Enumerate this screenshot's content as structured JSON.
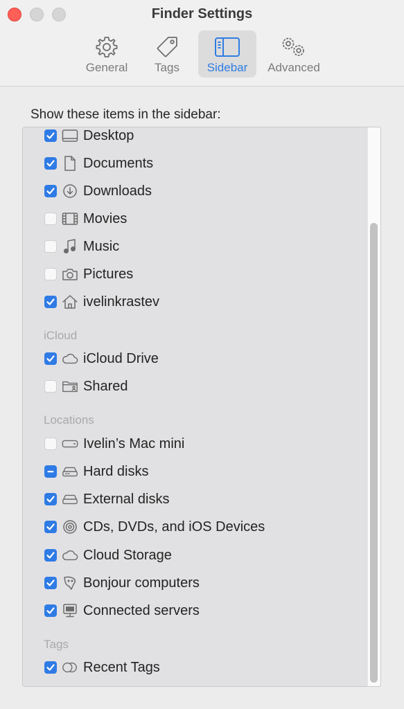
{
  "window": {
    "title": "Finder Settings"
  },
  "tabs": [
    {
      "label": "General",
      "icon": "gear-icon",
      "active": false
    },
    {
      "label": "Tags",
      "icon": "tag-icon",
      "active": false
    },
    {
      "label": "Sidebar",
      "icon": "sidebar-icon",
      "active": true
    },
    {
      "label": "Advanced",
      "icon": "gears-icon",
      "active": false
    }
  ],
  "prompt": "Show these items in the sidebar:",
  "favorites": [
    {
      "label": "Desktop",
      "icon": "desktop-icon",
      "state": "checked"
    },
    {
      "label": "Documents",
      "icon": "document-icon",
      "state": "checked"
    },
    {
      "label": "Downloads",
      "icon": "download-icon",
      "state": "checked"
    },
    {
      "label": "Movies",
      "icon": "film-icon",
      "state": "unchecked"
    },
    {
      "label": "Music",
      "icon": "music-note-icon",
      "state": "unchecked"
    },
    {
      "label": "Pictures",
      "icon": "camera-icon",
      "state": "unchecked"
    },
    {
      "label": "ivelinkrastev",
      "icon": "home-icon",
      "state": "checked"
    }
  ],
  "icloud": {
    "heading": "iCloud",
    "items": [
      {
        "label": "iCloud Drive",
        "icon": "cloud-icon",
        "state": "checked"
      },
      {
        "label": "Shared",
        "icon": "shared-folder-icon",
        "state": "unchecked"
      }
    ]
  },
  "locations": {
    "heading": "Locations",
    "items": [
      {
        "label": "Ivelin’s Mac mini",
        "icon": "mac-mini-icon",
        "state": "unchecked"
      },
      {
        "label": "Hard disks",
        "icon": "hard-disk-icon",
        "state": "mixed"
      },
      {
        "label": "External disks",
        "icon": "external-disk-icon",
        "state": "checked"
      },
      {
        "label": "CDs, DVDs, and iOS Devices",
        "icon": "disc-icon",
        "state": "checked"
      },
      {
        "label": "Cloud Storage",
        "icon": "cloud-icon",
        "state": "checked"
      },
      {
        "label": "Bonjour computers",
        "icon": "bonjour-icon",
        "state": "checked"
      },
      {
        "label": "Connected servers",
        "icon": "server-icon",
        "state": "checked"
      }
    ]
  },
  "tags": {
    "heading": "Tags",
    "items": [
      {
        "label": "Recent Tags",
        "icon": "tags-circles-icon",
        "state": "checked"
      }
    ]
  },
  "colors": {
    "accent": "#2f7be5",
    "close": "#fe5f57"
  }
}
